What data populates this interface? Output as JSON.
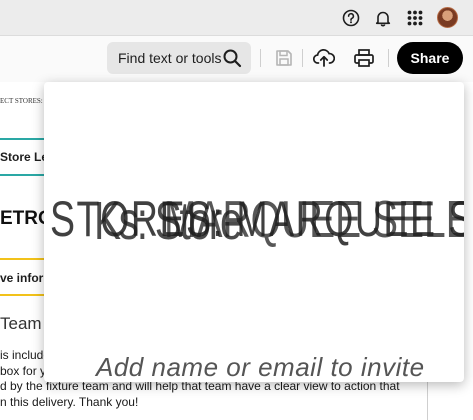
{
  "toolbar": {
    "find_label": "Find text or tools",
    "share_label": "Share"
  },
  "document": {
    "header_small": "ECT STORES: M",
    "store_leads": "Store Le",
    "metro_heading": "ETRO",
    "more_info": "ve inform",
    "team_heading": "Team L",
    "body_lines": [
      "is include",
      "box for y",
      "d by the fixture team and will help that team have a clear view to action that",
      "n this delivery.  Thank you!"
    ]
  },
  "share_popover": {
    "glitched_title_fragments": [
      "STORES: MARQUEE SELECT S",
      "Ks: Store",
      "MARQUEE SELECT"
    ],
    "invite_placeholder": "Add name or email to invite"
  },
  "colors": {
    "accent_teal": "#2aa8a5",
    "accent_yellow": "#f2c21a",
    "share_bg": "#000000"
  },
  "icons": [
    "help-icon",
    "notifications-icon",
    "apps-grid-icon",
    "avatar",
    "search-icon",
    "save-icon",
    "upload-icon",
    "print-icon"
  ]
}
